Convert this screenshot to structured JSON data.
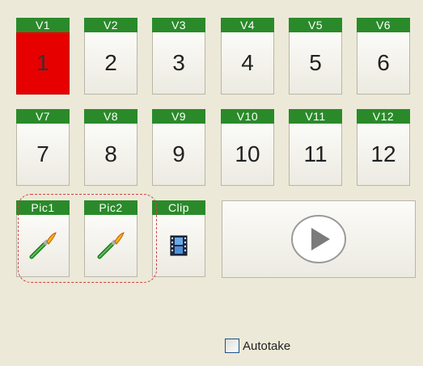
{
  "tiles": [
    {
      "tab": "V1",
      "value": "1",
      "active": true
    },
    {
      "tab": "V2",
      "value": "2"
    },
    {
      "tab": "V3",
      "value": "3"
    },
    {
      "tab": "V4",
      "value": "4"
    },
    {
      "tab": "V5",
      "value": "5"
    },
    {
      "tab": "V6",
      "value": "6"
    },
    {
      "tab": "V7",
      "value": "7"
    },
    {
      "tab": "V8",
      "value": "8"
    },
    {
      "tab": "V9",
      "value": "9"
    },
    {
      "tab": "V10",
      "value": "10"
    },
    {
      "tab": "V11",
      "value": "11"
    },
    {
      "tab": "V12",
      "value": "12"
    }
  ],
  "media": [
    {
      "tab": "Pic1",
      "icon": "paintbrush-icon"
    },
    {
      "tab": "Pic2",
      "icon": "paintbrush-icon"
    },
    {
      "tab": "Clip",
      "icon": "film-icon"
    }
  ],
  "player": {
    "icon": "play-icon"
  },
  "autotake": {
    "label": "Autotake",
    "checked": false
  },
  "colors": {
    "tab_green": "#2a8a2a",
    "active_red": "#e60000",
    "panel_bg": "#ece9d8"
  }
}
